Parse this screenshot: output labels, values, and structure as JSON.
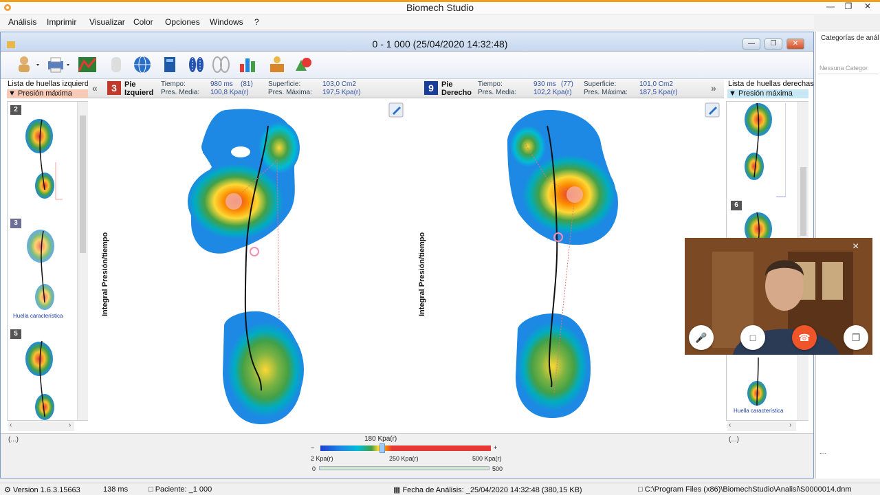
{
  "window": {
    "title": "Biomech Studio"
  },
  "menu": [
    "Análisis",
    "Imprimir",
    "Visualizar",
    "Color",
    "Opciones",
    "Windows",
    "?"
  ],
  "session_title": "0 -  1 000  (25/04/2020 14:32:48)",
  "left_list": {
    "title": "Lista de huellas izquierd",
    "sort": "Presión máxima",
    "items": [
      "2",
      "3",
      "5"
    ],
    "char_label": "Huella característica",
    "footer": "(...)"
  },
  "right_list": {
    "title": "Lista de huellas derechas",
    "sort": "Presión máxima",
    "items": [
      "6"
    ],
    "char_label": "Huella característica",
    "footer": "(...)"
  },
  "left_foot": {
    "num": "3",
    "label1": "Pie",
    "label2": "Izquierd",
    "time_label": "Tiempo:",
    "time": "980 ms",
    "time_n": "(81)",
    "mean_label": "Pres. Media:",
    "mean": "100,8 Kpa(r)",
    "area_label": "Superficie:",
    "area": "103,0 Cm2",
    "max_label": "Pres. Máxima:",
    "max": "197,5 Kpa(r)",
    "num_color": "#c0392b"
  },
  "right_foot": {
    "num": "9",
    "label1": "Pie",
    "label2": "Derecho",
    "time_label": "Tiempo:",
    "time": "930 ms",
    "time_n": "(77)",
    "mean_label": "Pres. Media:",
    "mean": "102,2 Kpa(r)",
    "area_label": "Superficie:",
    "area": "101,0 Cm2",
    "max_label": "Pres. Máxima:",
    "max": "187,5 Kpa(r)",
    "num_color": "#1a3d9a"
  },
  "axis_label": "Integral Presión/tiempo",
  "scale": {
    "top": "180 Kpa(r)",
    "min": "2 Kpa(r)",
    "mid": "250 Kpa(r)",
    "max": "500 Kpa(r)",
    "range_min": "0",
    "range_max": "500"
  },
  "status": {
    "version": "Version 1.6.3.15663",
    "ms": "138 ms",
    "patient": "Paciente: _1 000",
    "date": "Fecha de Análisis: _25/04/2020 14:32:48  (380,15 KB)",
    "path": "C:\\Program Files (x86)\\BiomechStudio\\Analisi\\S0000014.dnm"
  },
  "side": {
    "title": "Categorías de anál",
    "placeholder": "Nessuna Categor",
    "dots": "...."
  }
}
